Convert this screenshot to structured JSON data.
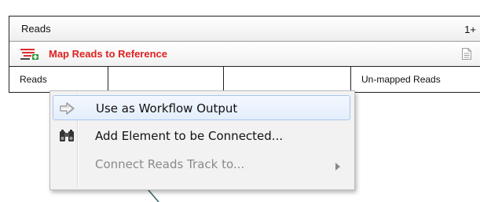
{
  "element": {
    "title": "Reads",
    "count": "1+",
    "tool_label": "Map Reads to Reference",
    "tool_icon": "map-reads-icon",
    "doc_icon": "document-icon",
    "ports": [
      "Reads",
      "",
      "",
      "Un-mapped Reads"
    ]
  },
  "context_menu": {
    "items": [
      {
        "label": "Use as Workflow Output",
        "icon": "arrow-right-icon",
        "highlighted": true,
        "enabled": true
      },
      {
        "label": "Add Element to be Connected...",
        "icon": "binoculars-icon",
        "highlighted": false,
        "enabled": true
      },
      {
        "label": "Connect Reads Track to...",
        "icon": "",
        "highlighted": false,
        "enabled": false,
        "has_submenu": true
      }
    ]
  },
  "colors": {
    "tool_label": "#e02020",
    "connection_line": "#3a6b6b",
    "highlight_border": "#a9c6ea"
  }
}
